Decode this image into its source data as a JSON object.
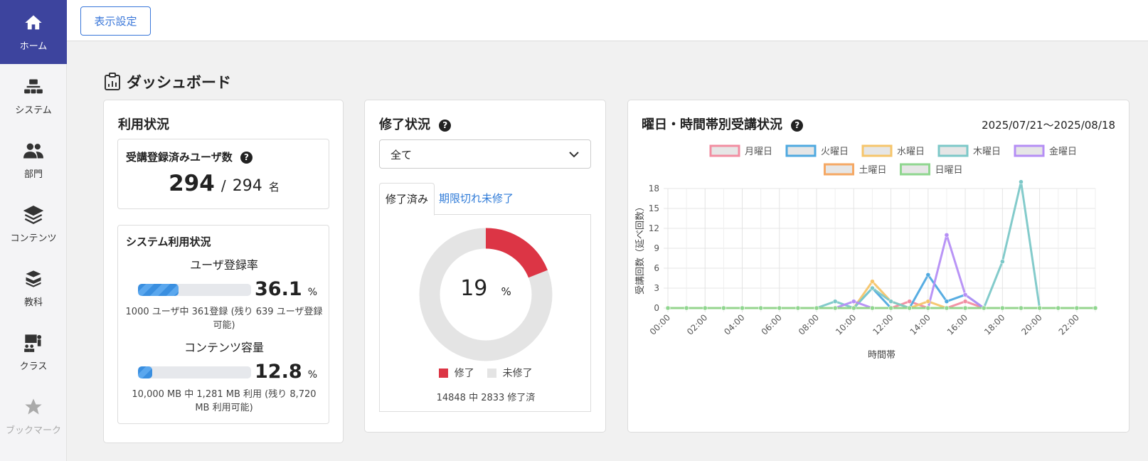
{
  "sidebar": {
    "items": [
      {
        "label": "ホーム",
        "icon": "home-icon"
      },
      {
        "label": "システム",
        "icon": "sitemap-icon"
      },
      {
        "label": "部門",
        "icon": "users-icon"
      },
      {
        "label": "コンテンツ",
        "icon": "layers-icon"
      },
      {
        "label": "教科",
        "icon": "books-icon"
      },
      {
        "label": "クラス",
        "icon": "classroom-icon"
      },
      {
        "label": "ブックマーク",
        "icon": "star-icon"
      }
    ]
  },
  "topbar": {
    "display_settings_label": "表示設定"
  },
  "dashboard": {
    "title": "ダッシュボード"
  },
  "usage": {
    "title": "利用状況",
    "registered_users": {
      "label": "受講登録済みユーザ数",
      "count": "294",
      "separator": "/",
      "total": "294",
      "unit": "名"
    },
    "system": {
      "title": "システム利用状況",
      "user_rate": {
        "label": "ユーザ登録率",
        "value": "36.1",
        "unit": "%",
        "fraction": 0.361,
        "line1": "1000 ユーザ中 361登録 (残り 639 ユーザ登録",
        "line2": "可能)"
      },
      "content": {
        "label": "コンテンツ容量",
        "value": "12.8",
        "unit": "%",
        "fraction": 0.128,
        "line1": "10,000 MB 中 1,281 MB 利用 (残り 8,720",
        "line2": "MB 利用可能)"
      }
    }
  },
  "completion": {
    "title": "修了状況",
    "select_value": "全て",
    "tabs": [
      "修了済み",
      "期限切れ未修了"
    ],
    "percent": "19",
    "percent_unit": "%",
    "legend": [
      "修了",
      "未修了"
    ],
    "summary": "14848 中 2833 修了済",
    "colors": {
      "done": "#dc3545",
      "not_done": "#e4e4e4"
    }
  },
  "weekly": {
    "title": "曜日・時間帯別受講状況",
    "date_range": "2025/07/21～2025/08/18"
  },
  "chart_data": {
    "type": "line",
    "xlabel": "時間帯",
    "ylabel": "受講回数（延べ回数）",
    "ylim": [
      0,
      18
    ],
    "yticks": [
      0,
      3,
      6,
      9,
      12,
      15,
      18
    ],
    "x": [
      "00:00",
      "01:00",
      "02:00",
      "03:00",
      "04:00",
      "05:00",
      "06:00",
      "07:00",
      "08:00",
      "09:00",
      "10:00",
      "11:00",
      "12:00",
      "13:00",
      "14:00",
      "15:00",
      "16:00",
      "17:00",
      "18:00",
      "19:00",
      "20:00",
      "21:00",
      "22:00",
      "23:00"
    ],
    "xtick_labels": [
      "00:00",
      "02:00",
      "04:00",
      "06:00",
      "08:00",
      "10:00",
      "12:00",
      "14:00",
      "16:00",
      "18:00",
      "20:00",
      "22:00"
    ],
    "legend_placement": "top",
    "grid": true,
    "series": [
      {
        "name": "月曜日",
        "color": "#f28da1",
        "values": [
          0,
          0,
          0,
          0,
          0,
          0,
          0,
          0,
          0,
          0,
          0,
          0,
          0,
          1,
          0,
          0,
          1,
          0,
          0,
          0,
          0,
          0,
          0,
          0
        ]
      },
      {
        "name": "火曜日",
        "color": "#4fa9e0",
        "values": [
          0,
          0,
          0,
          0,
          0,
          0,
          0,
          0,
          0,
          0,
          0,
          3,
          0,
          0,
          5,
          1,
          2,
          0,
          0,
          0,
          0,
          0,
          0,
          0
        ]
      },
      {
        "name": "水曜日",
        "color": "#f6c56b",
        "values": [
          0,
          0,
          0,
          0,
          0,
          0,
          0,
          0,
          0,
          0,
          0,
          4,
          1,
          0,
          1,
          0,
          0,
          0,
          0,
          0,
          0,
          0,
          0,
          0
        ]
      },
      {
        "name": "木曜日",
        "color": "#7cc8c8",
        "values": [
          0,
          0,
          0,
          0,
          0,
          0,
          0,
          0,
          0,
          1,
          0,
          3,
          1,
          0,
          0,
          0,
          0,
          0,
          7,
          19,
          0,
          0,
          0,
          0
        ]
      },
      {
        "name": "金曜日",
        "color": "#b58ef5",
        "values": [
          0,
          0,
          0,
          0,
          0,
          0,
          0,
          0,
          0,
          0,
          1,
          0,
          0,
          0,
          0,
          11,
          2,
          0,
          0,
          0,
          0,
          0,
          0,
          0
        ]
      },
      {
        "name": "土曜日",
        "color": "#f5a864",
        "values": [
          0,
          0,
          0,
          0,
          0,
          0,
          0,
          0,
          0,
          0,
          0,
          0,
          0,
          0,
          0,
          0,
          0,
          0,
          0,
          0,
          0,
          0,
          0,
          0
        ]
      },
      {
        "name": "日曜日",
        "color": "#8fd68f",
        "values": [
          0,
          0,
          0,
          0,
          0,
          0,
          0,
          0,
          0,
          0,
          0,
          0,
          0,
          0,
          0,
          0,
          0,
          0,
          0,
          0,
          0,
          0,
          0,
          0
        ]
      }
    ]
  }
}
